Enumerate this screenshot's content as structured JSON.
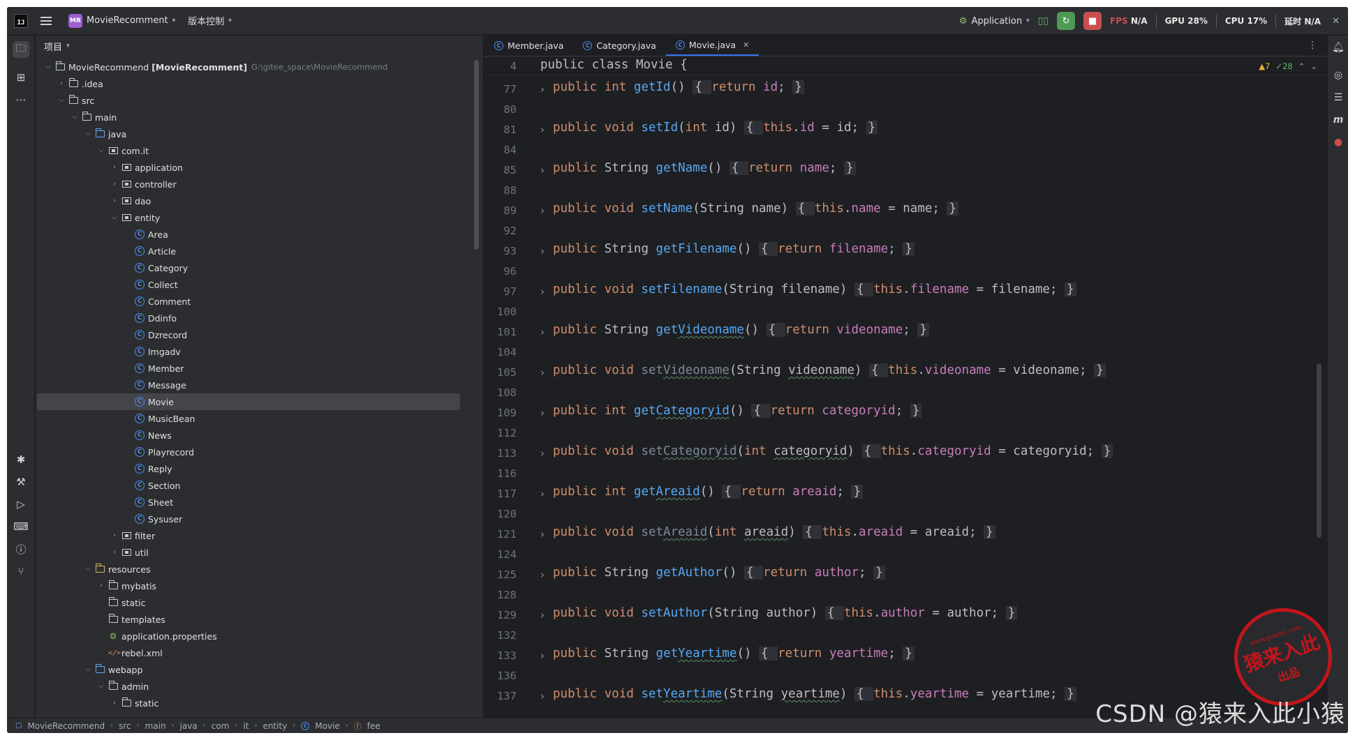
{
  "titlebar": {
    "project_badge": "MR",
    "project_name": "MovieRecomment",
    "vcs": "版本控制",
    "run_config": "Application",
    "fps_label": "FPS",
    "fps_value": "N/A",
    "gpu_label": "GPU",
    "gpu_value": "28%",
    "cpu_label": "CPU",
    "cpu_value": "17%",
    "time_label": "延时",
    "time_value": "N/A"
  },
  "project_panel": {
    "title": "项目",
    "root_name": "MovieRecommend",
    "root_module": "[MovieRecomment]",
    "root_path": "G:\\gitee_space\\MovieRecommend",
    "items": [
      {
        "label": ".idea"
      },
      {
        "label": "src"
      },
      {
        "label": "main"
      },
      {
        "label": "java"
      },
      {
        "label": "com.it"
      },
      {
        "label": "application"
      },
      {
        "label": "controller"
      },
      {
        "label": "dao"
      },
      {
        "label": "entity"
      },
      {
        "label": "Area"
      },
      {
        "label": "Article"
      },
      {
        "label": "Category"
      },
      {
        "label": "Collect"
      },
      {
        "label": "Comment"
      },
      {
        "label": "Ddinfo"
      },
      {
        "label": "Dzrecord"
      },
      {
        "label": "Imgadv"
      },
      {
        "label": "Member"
      },
      {
        "label": "Message"
      },
      {
        "label": "Movie"
      },
      {
        "label": "MusicBean"
      },
      {
        "label": "News"
      },
      {
        "label": "Playrecord"
      },
      {
        "label": "Reply"
      },
      {
        "label": "Section"
      },
      {
        "label": "Sheet"
      },
      {
        "label": "Sysuser"
      },
      {
        "label": "filter"
      },
      {
        "label": "util"
      },
      {
        "label": "resources"
      },
      {
        "label": "mybatis"
      },
      {
        "label": "static"
      },
      {
        "label": "templates"
      },
      {
        "label": "application.properties"
      },
      {
        "label": "rebel.xml"
      },
      {
        "label": "webapp"
      },
      {
        "label": "admin"
      },
      {
        "label": "static"
      }
    ]
  },
  "editor": {
    "tabs": [
      {
        "label": "Member.java"
      },
      {
        "label": "Category.java"
      },
      {
        "label": "Movie.java"
      }
    ],
    "sticky_line_number": "4",
    "sticky_line": "public class Movie {",
    "warnings": "▲7",
    "checks": "✓28",
    "line_numbers": [
      "77",
      "80",
      "81",
      "84",
      "85",
      "88",
      "89",
      "92",
      "93",
      "96",
      "97",
      "100",
      "101",
      "104",
      "105",
      "108",
      "109",
      "112",
      "113",
      "116",
      "117",
      "120",
      "121",
      "124",
      "125",
      "128",
      "129",
      "132",
      "133",
      "136",
      "137"
    ]
  },
  "statusbar": {
    "crumbs": [
      "MovieRecommend",
      "src",
      "main",
      "java",
      "com",
      "it",
      "entity",
      "Movie",
      "fee"
    ]
  },
  "watermark": {
    "text": "CSDN @猿来入此小猿",
    "stamp_top": "www.yuanrc.com",
    "stamp_main": "猿来入此",
    "stamp_bottom": "出品"
  }
}
